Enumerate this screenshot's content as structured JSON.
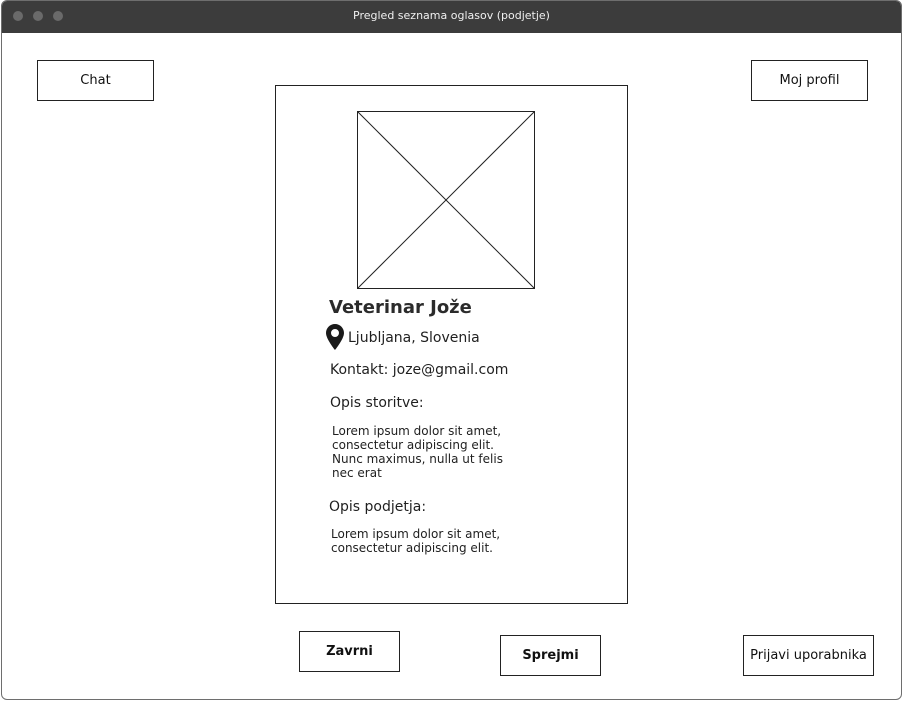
{
  "window": {
    "title": "Pregled seznama oglasov (podjetje)"
  },
  "header": {
    "chat_label": "Chat",
    "profile_label": "Moj profil"
  },
  "card": {
    "name": "Veterinar Jože",
    "location": "Ljubljana, Slovenia",
    "contact": "Kontakt: joze@gmail.com",
    "service_label": "Opis storitve:",
    "service_text": "Lorem ipsum dolor sit amet,\nconsectetur adipiscing elit.\nNunc maximus, nulla ut  felis\nnec erat",
    "company_label": "Opis podjetja:",
    "company_text": "Lorem ipsum dolor sit amet,\nconsectetur adipiscing elit."
  },
  "footer": {
    "reject_label": "Zavrni",
    "accept_label": "Sprejmi",
    "report_label": "Prijavi uporabnika"
  }
}
